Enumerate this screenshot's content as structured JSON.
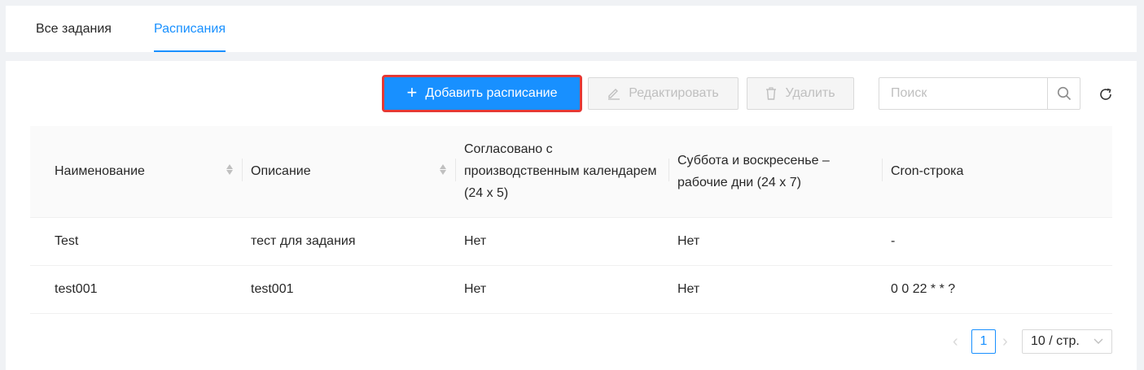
{
  "tabs": [
    {
      "label": "Все задания"
    },
    {
      "label": "Расписания"
    }
  ],
  "toolbar": {
    "add_label": "Добавить расписание",
    "edit_label": "Редактировать",
    "delete_label": "Удалить",
    "search_placeholder": "Поиск"
  },
  "table": {
    "headers": [
      "Наименование",
      "Описание",
      "Согласовано с производственным календарем (24 x 5)",
      "Суббота и воскресенье – рабочие дни (24 x 7)",
      "Cron-строка"
    ],
    "rows": [
      [
        "Test",
        "тест для задания",
        "Нет",
        "Нет",
        "-"
      ],
      [
        "test001",
        "test001",
        "Нет",
        "Нет",
        "0 0 22 * * ?"
      ]
    ]
  },
  "pagination": {
    "current_page": "1",
    "page_size": "10 / стр."
  },
  "colors": {
    "primary": "#1890ff",
    "highlight_border": "#e53935"
  }
}
